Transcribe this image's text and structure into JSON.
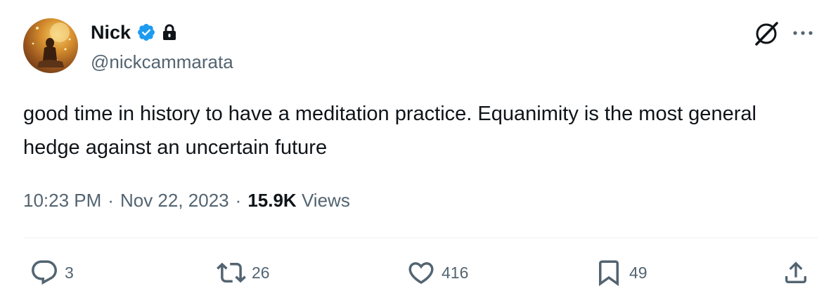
{
  "author": {
    "display_name": "Nick",
    "handle": "@nickcammarata",
    "verified": true,
    "protected": true
  },
  "tweet": {
    "text": "good time in history to have a meditation practice. Equanimity is the most general hedge against an uncertain future",
    "time": "10:23 PM",
    "separator": "·",
    "date": "Nov 22, 2023",
    "views_count": "15.9K",
    "views_label": "Views"
  },
  "actions": {
    "replies": "3",
    "reposts": "26",
    "likes": "416",
    "bookmarks": "49"
  },
  "icons": {
    "verified": "verified-badge-icon",
    "protected": "lock-icon",
    "grok": "grok-icon",
    "more": "more-icon",
    "reply": "reply-icon",
    "retweet": "retweet-icon",
    "like": "heart-icon",
    "bookmark": "bookmark-icon",
    "share": "share-icon"
  },
  "colors": {
    "text": "#0f1419",
    "secondary": "#536471",
    "verified": "#1d9bf0",
    "divider": "#eff3f4"
  }
}
